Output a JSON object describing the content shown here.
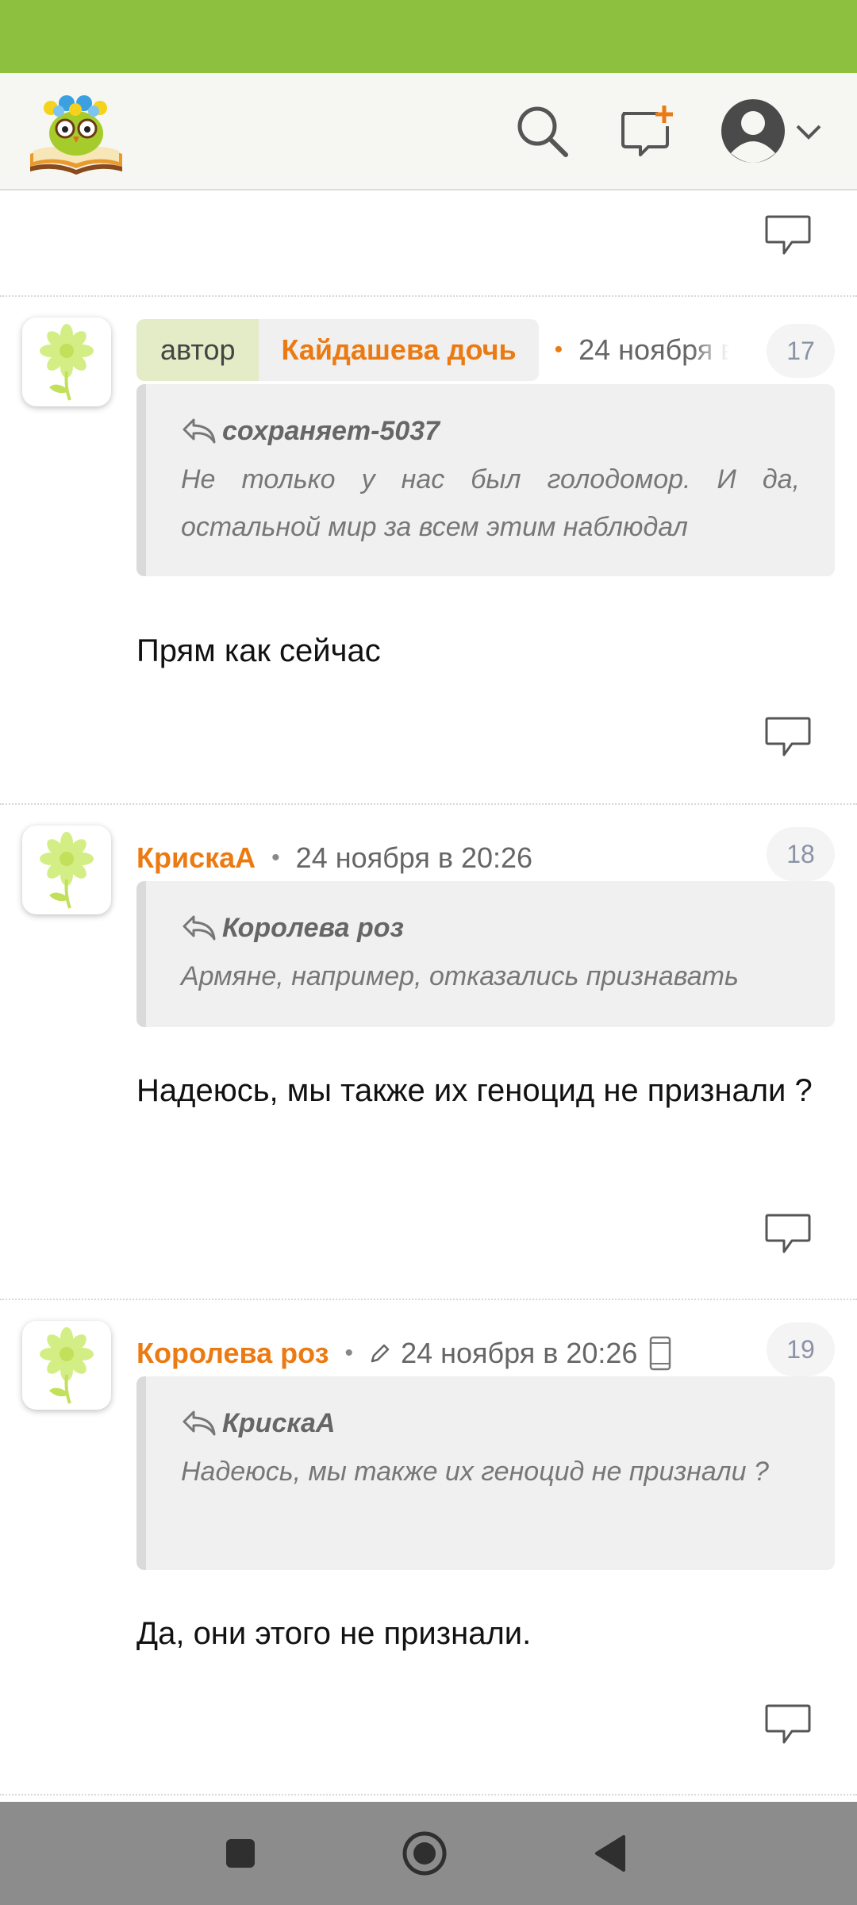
{
  "colors": {
    "accent_green": "#8dc03f",
    "username_orange": "#ec7a12",
    "quote_bg": "#f0f0f0"
  },
  "header": {
    "logo_icon": "book-owl-logo",
    "icons": [
      "search-icon",
      "new-post-icon",
      "user-avatar-icon",
      "chevron-down-icon"
    ]
  },
  "comments": [
    {
      "is_author": true,
      "author_tag": "автор",
      "username": "Кайдашева дочь",
      "date": "24 ноября в",
      "number": "17",
      "quote": {
        "author": "сохраняет-5037",
        "text": "Не только у нас был голодомор. И да, остальной мир за всем этим наблюдал"
      },
      "text": "Прям как сейчас"
    },
    {
      "is_author": false,
      "username": "КрискаА",
      "date": "24 ноября в 20:26",
      "number": "18",
      "quote": {
        "author": "Королева роз",
        "text": "Армяне, например, отказались признавать"
      },
      "text": "Надеюсь, мы также их геноцид не признали ?"
    },
    {
      "is_author": false,
      "username": "Королева роз",
      "edited": true,
      "mobile": true,
      "date": "24 ноября в 20:26",
      "number": "19",
      "quote": {
        "author": "КрискаА",
        "text": "Надеюсь, мы также их геноцид не признали ?"
      },
      "text": "Да, они этого не признали."
    }
  ],
  "nav": {
    "icons": [
      "recent-apps-icon",
      "home-icon",
      "back-icon"
    ]
  }
}
